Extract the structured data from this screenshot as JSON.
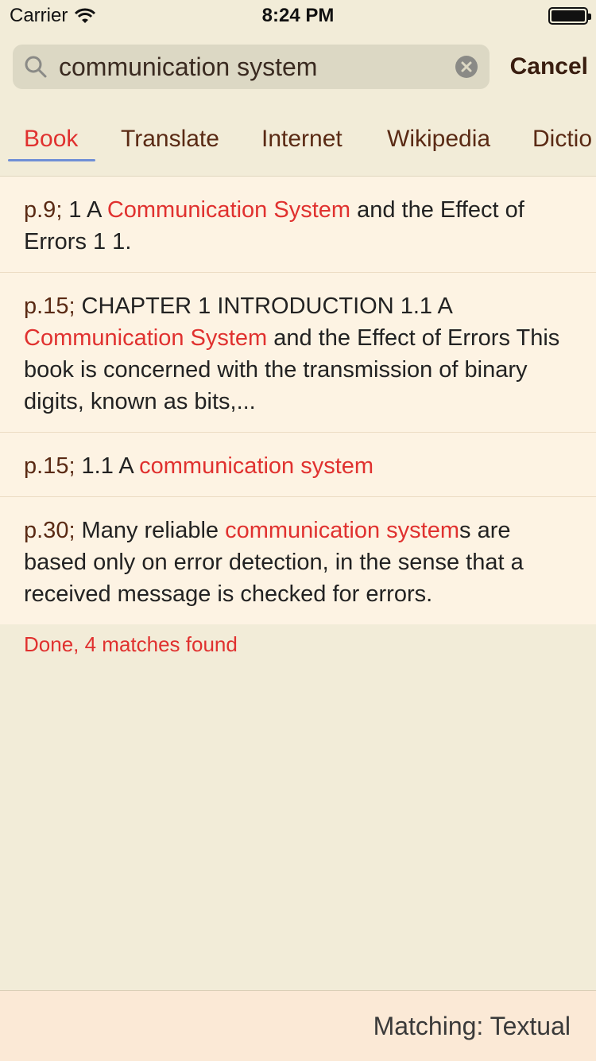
{
  "status": {
    "carrier": "Carrier",
    "time": "8:24 PM"
  },
  "search": {
    "query": "communication system",
    "cancel_label": "Cancel"
  },
  "tabs": [
    {
      "label": "Book",
      "active": true
    },
    {
      "label": "Translate",
      "active": false
    },
    {
      "label": "Internet",
      "active": false
    },
    {
      "label": "Wikipedia",
      "active": false
    },
    {
      "label": "Dictio",
      "active": false
    }
  ],
  "results": [
    {
      "page": "p.9;",
      "before": " 1 A ",
      "match": "Communication System",
      "after": " and the Effect of Errors 1 1."
    },
    {
      "page": "p.15;",
      "before": " CHAPTER 1 INTRODUCTION 1.1 A ",
      "match": "Communication System",
      "after": " and the Effect of Errors This book is concerned with the transmission of binary digits, known as bits,..."
    },
    {
      "page": "p.15;",
      "before": " 1.1 A ",
      "match": "communication system",
      "after": ""
    },
    {
      "page": "p.30;",
      "before": " Many reliable ",
      "match": "communication system",
      "after": "s are based only on error detection, in the sense that a received message is checked for errors."
    }
  ],
  "footer": {
    "done": "Done, 4 matches found",
    "matching": "Matching: Textual"
  },
  "colors": {
    "highlight": "#e0312f",
    "accent_underline": "#6f8fd6",
    "background": "#f2ecd8",
    "results_bg": "#fdf3e3"
  }
}
